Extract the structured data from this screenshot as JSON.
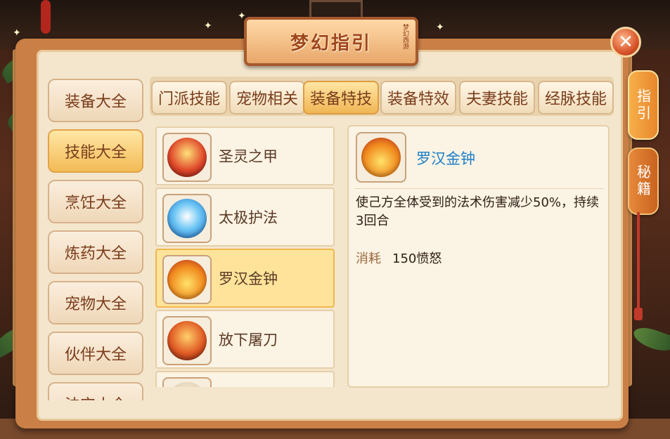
{
  "title": "梦幻指引",
  "title_stamp": "梦幻西游",
  "close_icon": "close-icon",
  "side_tabs": [
    {
      "label": "指引"
    },
    {
      "label": "秘籍"
    }
  ],
  "categories": [
    {
      "label": "装备大全",
      "active": false
    },
    {
      "label": "技能大全",
      "active": true
    },
    {
      "label": "烹饪大全",
      "active": false
    },
    {
      "label": "炼药大全",
      "active": false
    },
    {
      "label": "宠物大全",
      "active": false
    },
    {
      "label": "伙伴大全",
      "active": false
    },
    {
      "label": "法宝大全",
      "active": false
    }
  ],
  "tabs": [
    {
      "label": "门派技能",
      "active": false
    },
    {
      "label": "宠物相关",
      "active": false
    },
    {
      "label": "装备特技",
      "active": true
    },
    {
      "label": "装备特效",
      "active": false
    },
    {
      "label": "夫妻技能",
      "active": false
    },
    {
      "label": "经脉技能",
      "active": false
    }
  ],
  "skills": [
    {
      "name": "圣灵之甲",
      "icon": "armor-icon",
      "selected": false
    },
    {
      "name": "太极护法",
      "icon": "taiji-icon",
      "selected": false
    },
    {
      "name": "罗汉金钟",
      "icon": "golden-bell-icon",
      "selected": true
    },
    {
      "name": "放下屠刀",
      "icon": "blade-icon",
      "selected": false
    }
  ],
  "detail": {
    "name": "罗汉金钟",
    "icon": "golden-bell-icon",
    "description": "使己方全体受到的法术伤害减少50%，持续3回合",
    "cost_label": "消耗",
    "cost_value": "150愤怒"
  },
  "colors": {
    "frame": "#c97f45",
    "panel": "#f4e6cc",
    "active_tab": "#f0b655",
    "selected_row": "#ffe39a",
    "skill_name_highlight": "#1d7fc9"
  }
}
